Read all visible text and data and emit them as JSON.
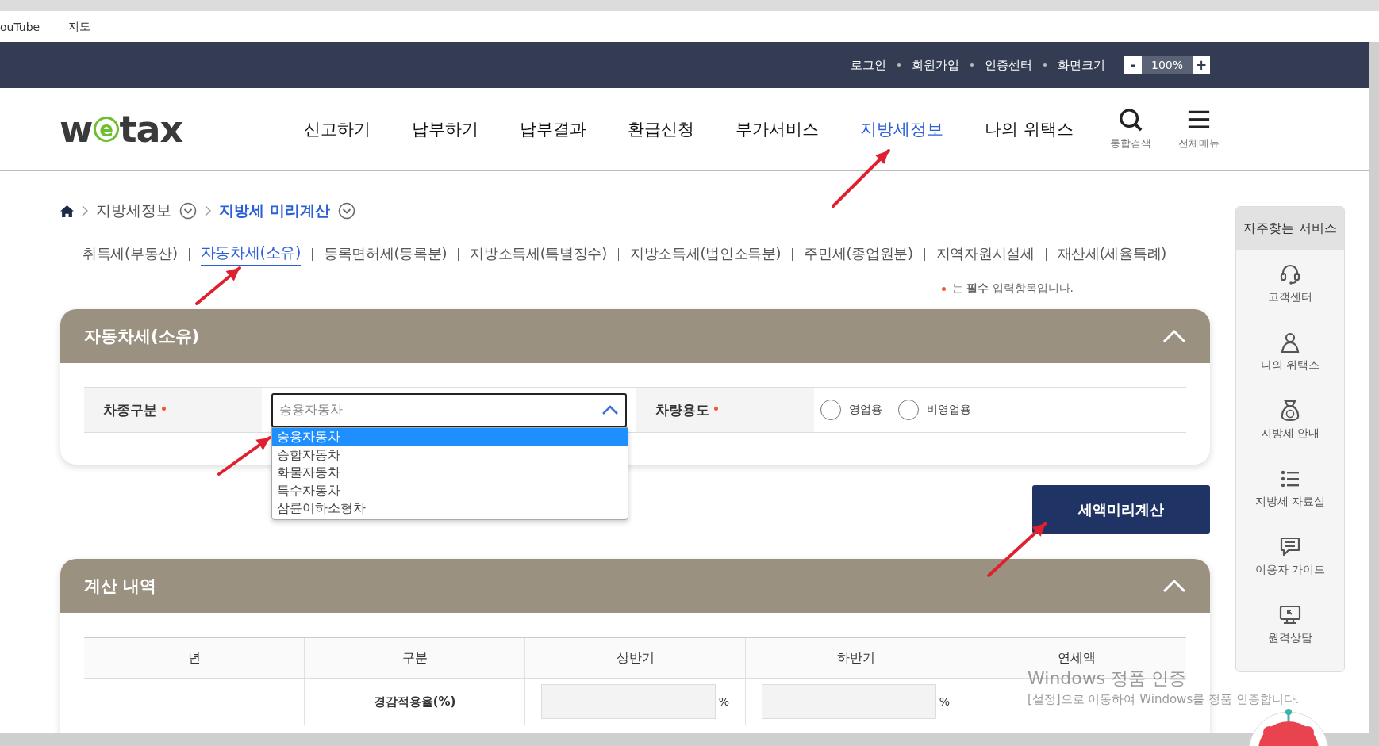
{
  "bookmarks": [
    {
      "label": "ouTube",
      "kind": "text"
    },
    {
      "label": "지도",
      "kind": "map"
    }
  ],
  "topbar": {
    "links": [
      "로그인",
      "회원가입",
      "인증센터",
      "화면크기"
    ],
    "zoom": {
      "minus": "-",
      "value": "100%",
      "plus": "+"
    }
  },
  "header": {
    "logo": {
      "before": "w",
      "mark": "e",
      "after": "tax"
    },
    "nav": [
      {
        "label": "신고하기",
        "selected": false
      },
      {
        "label": "납부하기",
        "selected": false
      },
      {
        "label": "납부결과",
        "selected": false
      },
      {
        "label": "환급신청",
        "selected": false
      },
      {
        "label": "부가서비스",
        "selected": false
      },
      {
        "label": "지방세정보",
        "selected": true
      },
      {
        "label": "나의 위택스",
        "selected": false
      }
    ],
    "tools": [
      {
        "label": "통합검색",
        "kind": "search"
      },
      {
        "label": "전체메뉴",
        "kind": "menu"
      }
    ]
  },
  "breadcrumb": [
    {
      "label": "지방세정보",
      "selected": false
    },
    {
      "label": "지방세 미리계산",
      "selected": true
    }
  ],
  "tax_tabs": [
    {
      "label": "취득세(부동산)",
      "selected": false
    },
    {
      "label": "자동차세(소유)",
      "selected": true
    },
    {
      "label": "등록면허세(등록분)",
      "selected": false
    },
    {
      "label": "지방소득세(특별징수)",
      "selected": false
    },
    {
      "label": "지방소득세(법인소득분)",
      "selected": false
    },
    {
      "label": "주민세(종업원분)",
      "selected": false
    },
    {
      "label": "지역자원시설세",
      "selected": false
    },
    {
      "label": "재산세(세율특례)",
      "selected": false
    }
  ],
  "required_note": "는 **필수** 입력항목입니다.",
  "vehicle_panel": {
    "title": "자동차세(소유)",
    "expanded": true,
    "type_field": {
      "label": "차종구분",
      "required": true,
      "value": "승용자동차",
      "open": true,
      "options": [
        {
          "label": "승용자동차",
          "selected": true
        },
        {
          "label": "승합자동차",
          "selected": false
        },
        {
          "label": "화물자동차",
          "selected": false
        },
        {
          "label": "특수자동차",
          "selected": false
        },
        {
          "label": "삼륜이하소형차",
          "selected": false
        }
      ]
    },
    "usage_field": {
      "label": "차량용도",
      "required": true,
      "options": [
        {
          "label": "영업용",
          "selected": false
        },
        {
          "label": "비영업용",
          "selected": false
        }
      ]
    }
  },
  "calc_button": "세액미리계산",
  "result_panel": {
    "title": "계산 내역",
    "expanded": true,
    "columns": [
      "년",
      "구분",
      "상반기",
      "하반기",
      "연세액"
    ],
    "rows": [
      {
        "label": "경감적용율(%)",
        "cells": [
          {
            "kind": "input",
            "unit": "%"
          },
          {
            "kind": "input",
            "unit": "%"
          }
        ]
      }
    ]
  },
  "quick_menu": {
    "title": "자주찾는 서비스",
    "items": [
      {
        "label": "고객센터",
        "kind": "headset"
      },
      {
        "label": "나의 위택스",
        "kind": "person"
      },
      {
        "label": "지방세 안내",
        "kind": "bag"
      },
      {
        "label": "지방세 자료실",
        "kind": "list"
      },
      {
        "label": "이용자 가이드",
        "kind": "chat"
      },
      {
        "label": "원격상담",
        "kind": "monitor"
      }
    ]
  },
  "os_watermark": {
    "title": "Windows 정품 인증",
    "text": "[설정]으로 이동하여 Windows를 정품 인증합니다."
  }
}
